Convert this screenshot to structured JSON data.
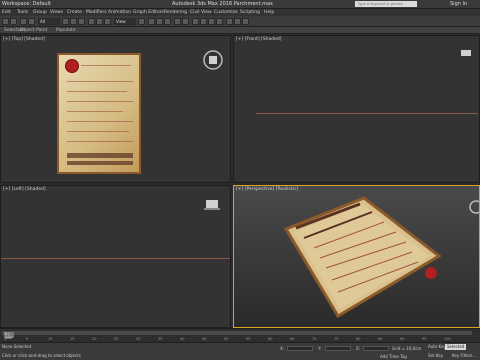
{
  "titlebar": {
    "workspace": "Workspace: Default",
    "title": "Autodesk 3ds Max 2016    Parchment.max",
    "search_placeholder": "Type a keyword or phrase",
    "sign_in": "Sign In"
  },
  "menu": [
    "Edit",
    "Tools",
    "Group",
    "Views",
    "Create",
    "Modifiers",
    "Animation",
    "Graph Editors",
    "Rendering",
    "Civil View",
    "Customize",
    "Scripting",
    "Help"
  ],
  "toolbar": {
    "selection_filter": "All",
    "view_dropdown": "View"
  },
  "ribbon": {
    "tabs": [
      "Selection",
      "Object Paint",
      "Populate"
    ]
  },
  "viewports": {
    "top_label": "[+] [Top] [Shaded]",
    "front_label": "[+] [Front] [Shaded]",
    "left_label": "[+] [Left] [Shaded]",
    "persp_label": "[+] [Perspective] [Realistic]"
  },
  "timeline": {
    "frame_counter": "0 / 100",
    "ticks": [
      "0",
      "5",
      "10",
      "15",
      "20",
      "25",
      "30",
      "35",
      "40",
      "45",
      "50",
      "55",
      "60",
      "65",
      "70",
      "75",
      "80",
      "85",
      "90",
      "95",
      "100"
    ]
  },
  "status": {
    "selection": "None Selected",
    "prompt": "Click or click-and-drag to select objects",
    "x_label": "X:",
    "y_label": "Y:",
    "z_label": "Z:",
    "grid": "Grid = 10,0cm",
    "auto_key": "Auto Key",
    "selected": "Selected",
    "set_key": "Set Key",
    "key_filters": "Key Filters...",
    "add_time_tag": "Add Time Tag"
  }
}
